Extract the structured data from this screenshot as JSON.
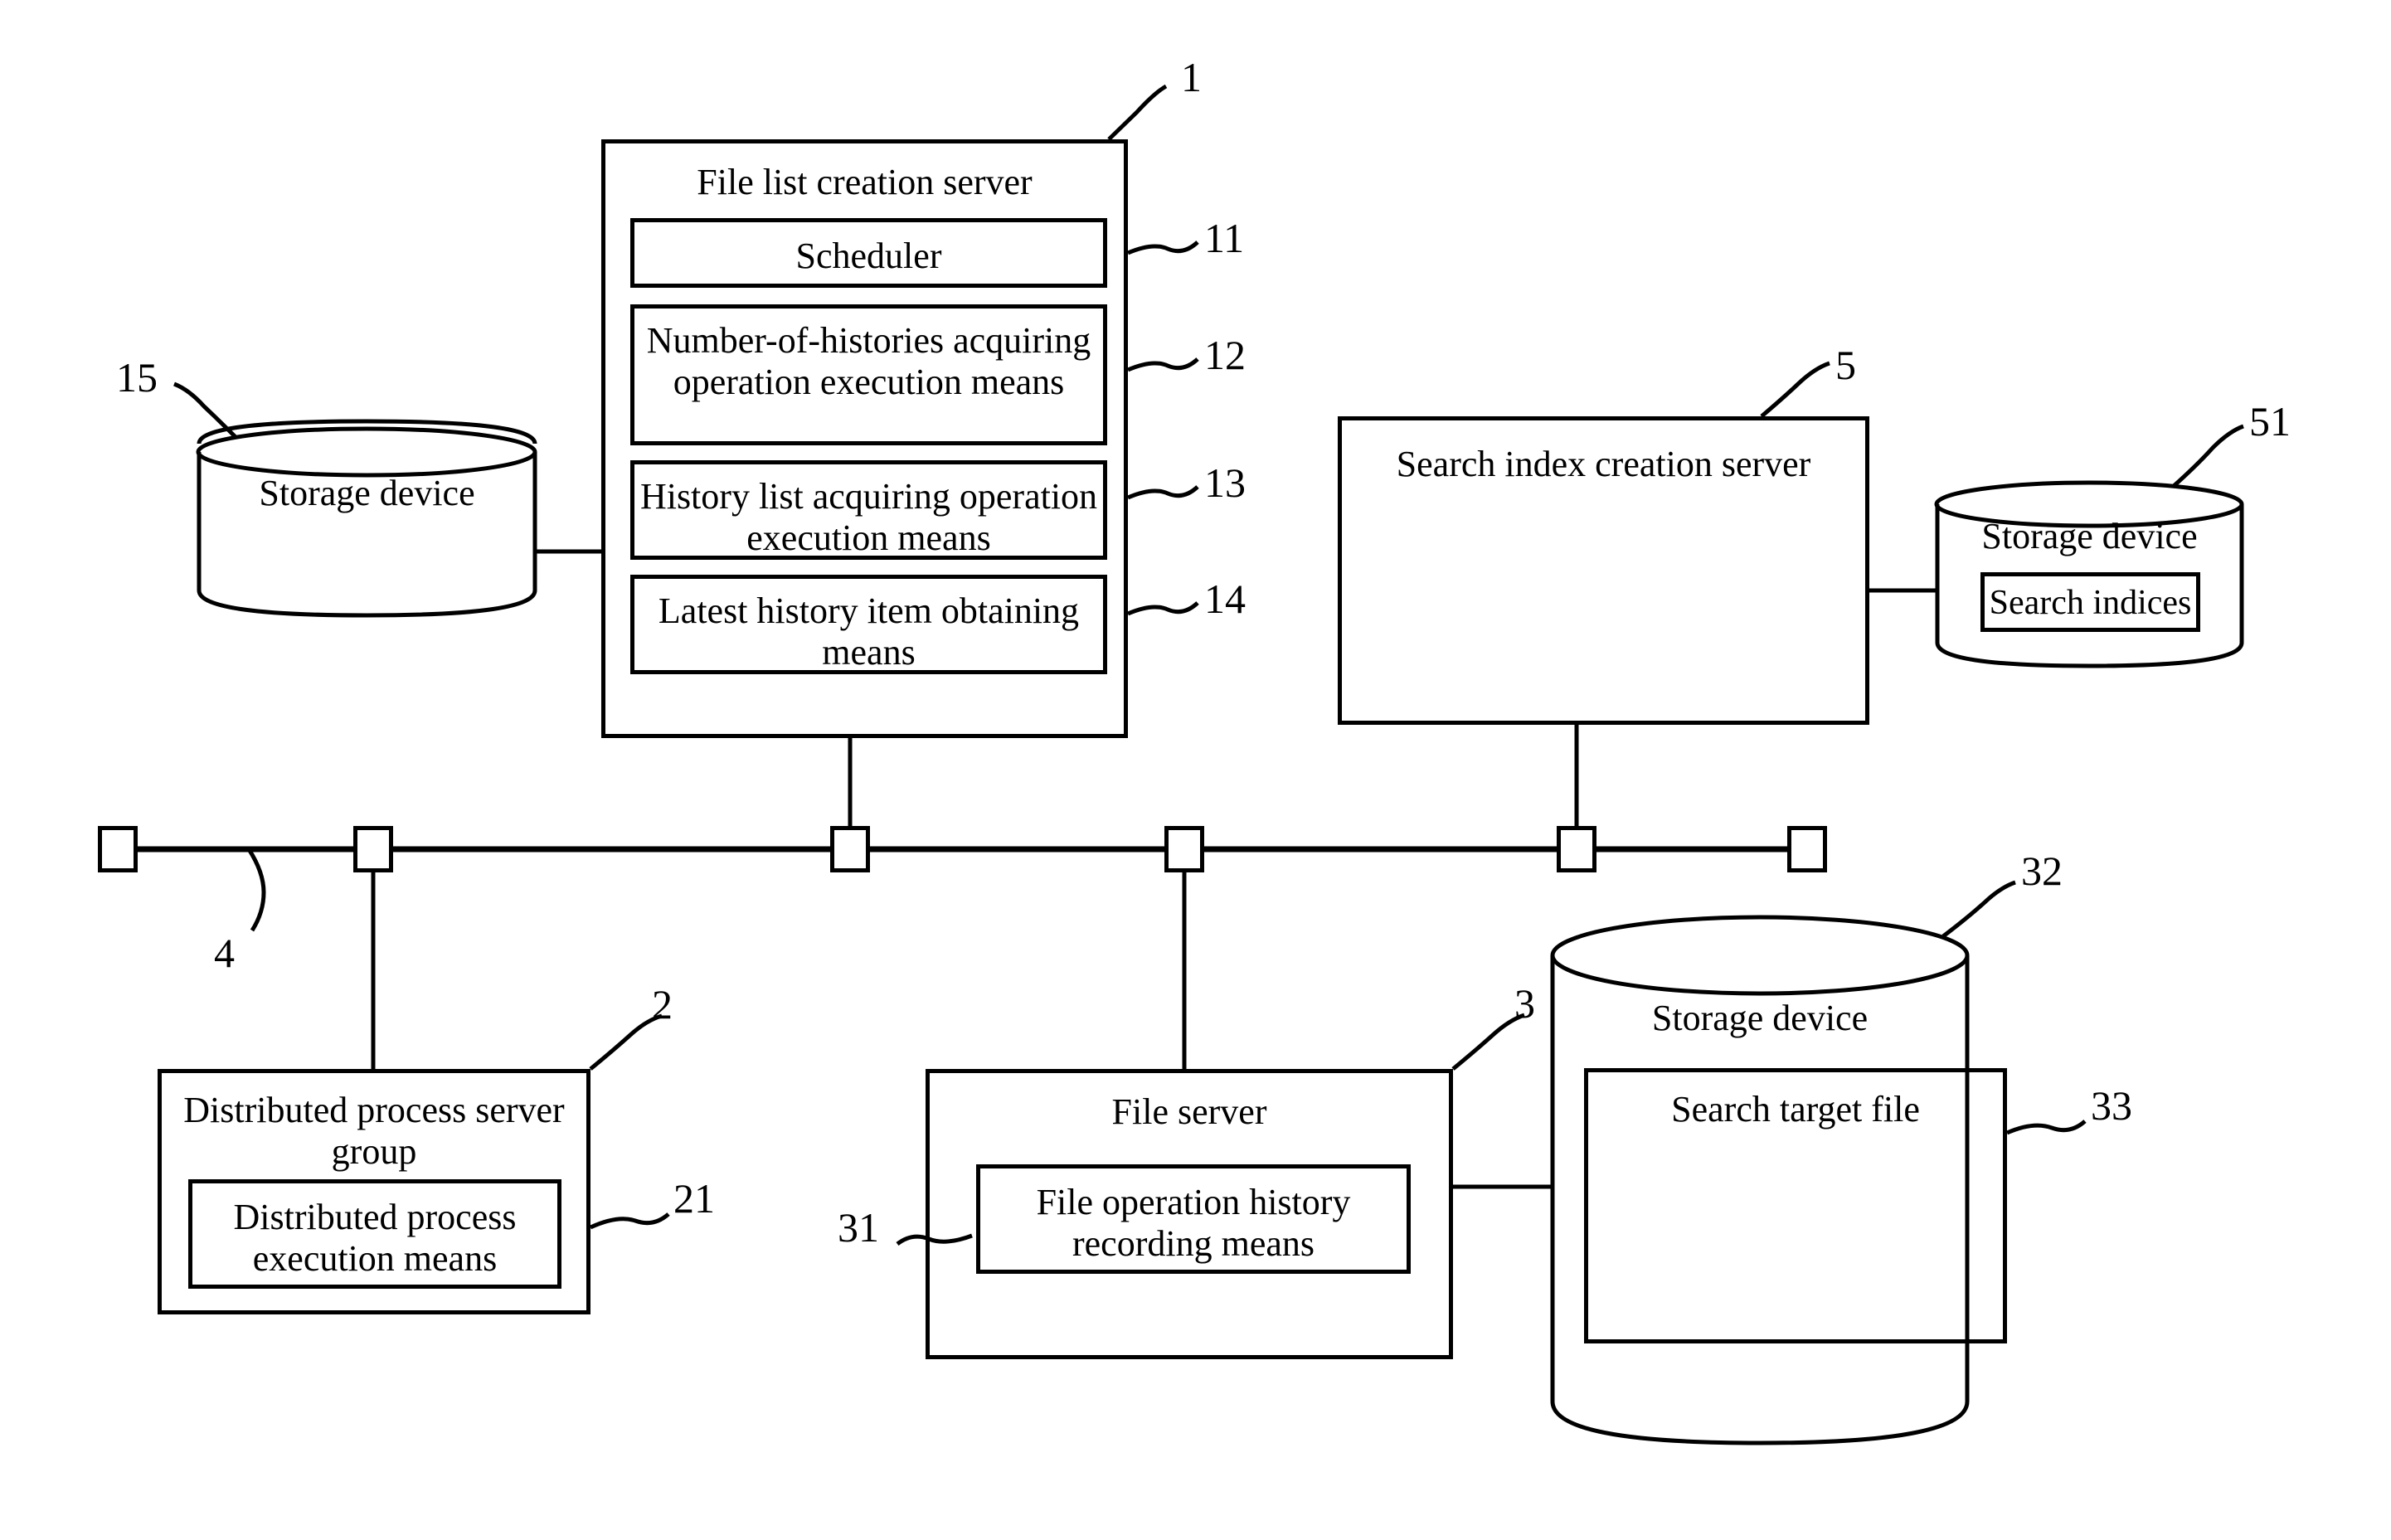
{
  "figure": {
    "type": "patent-system-block-diagram",
    "background_color": "#ffffff",
    "line_color": "#000000"
  },
  "nodes": {
    "file_list_creation_server": {
      "title": "File list creation server",
      "ref": "1",
      "children": [
        {
          "label": "Scheduler",
          "ref": "11"
        },
        {
          "label": "Number-of-histories\nacquiring operation\nexecution means",
          "ref": "12"
        },
        {
          "label": "History list acquiring\noperation execution means",
          "ref": "13"
        },
        {
          "label": "Latest history item\nobtaining means",
          "ref": "14"
        }
      ]
    },
    "storage_device_15": {
      "title": "Storage device",
      "ref": "15"
    },
    "search_index_creation_server": {
      "title": "Search index creation server",
      "ref": "5"
    },
    "storage_device_51": {
      "title": "Storage device",
      "ref": "51",
      "children": [
        {
          "label": "Search indices"
        }
      ]
    },
    "network_bus": {
      "ref": "4"
    },
    "distributed_process_server_group": {
      "title": "Distributed process\nserver group",
      "ref": "2",
      "children": [
        {
          "label": "Distributed process\nexecution means",
          "ref": "21"
        }
      ]
    },
    "file_server": {
      "title": "File server",
      "ref": "3",
      "children": [
        {
          "label": "File operation history\nrecording means",
          "ref": "31"
        }
      ]
    },
    "storage_device_32": {
      "title": "Storage device",
      "ref": "32",
      "children": [
        {
          "label": "Search target file",
          "ref": "33"
        }
      ]
    }
  },
  "reference_numerals": {
    "n1": "1",
    "n2": "2",
    "n3": "3",
    "n4": "4",
    "n5": "5",
    "n11": "11",
    "n12": "12",
    "n13": "13",
    "n14": "14",
    "n15": "15",
    "n21": "21",
    "n31": "31",
    "n32": "32",
    "n33": "33",
    "n51": "51"
  }
}
